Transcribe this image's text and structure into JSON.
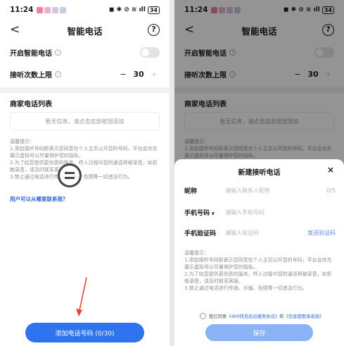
{
  "status": {
    "time": "11:24",
    "battery": "34",
    "icons": "◼ ✱ ⊘ ≋ ıll"
  },
  "blur_colors": [
    "#f07fa0",
    "#e7b2cc",
    "#d6c3dd",
    "#c9c9ea"
  ],
  "header": {
    "back": "<",
    "title": "智能电话",
    "help": "?"
  },
  "settings": {
    "enable_label": "开启智能电话",
    "limit_label": "接听次数上限",
    "limit_value": "30",
    "minus": "−",
    "plus": "+"
  },
  "list": {
    "title": "商家电话列表",
    "empty_text": "暂无信息，请点击底部按钮添加"
  },
  "notes_left": {
    "heading": "温馨提示：",
    "item1": "1.添加接听号码即表示您同意在个人主页公开您的号码，平台会优先展示虚拟号以尽量保护您的隐私。",
    "item2": "2.为了给您提供更优质的服务，呼入过程中您的通话将被录音，如拒绝录音，请及时联系客服。",
    "item3": "3.禁止通过电话进行传销、诈骗、色情等一切违法行为。"
  },
  "link_text": "用户可以从哪里联系我？",
  "add_button": "添加电话号码 (0/30)",
  "arrow_color": "#e8452f",
  "sheet": {
    "title": "新建接听电话",
    "close": "×",
    "nickname_label": "昵称",
    "nickname_placeholder": "请输入联系人昵称",
    "nickname_count": "0/5",
    "phone_label": "手机号码",
    "phone_caret": "∨",
    "phone_placeholder": "请输入手机号码",
    "code_label": "手机验证码",
    "code_placeholder": "请输入验证码",
    "send_code": "发送验证码",
    "notes_heading": "温馨提示：",
    "note1": "1.添加接听号码即表示您同意在个人主页公开您的号码，平台会优先展示虚拟号以尽量保护您的隐私。",
    "note2": "2.为了给您提供更优质的服务，呼入过程中您的通话将被录音，如拒绝录音，请及时联系客服。",
    "note3": "3.禁止通过电话进行传销、诈骗、色情等一切违法行为。",
    "agree_prefix": "我已同意",
    "agree_doc1": "《400快充后台服务协议》",
    "agree_and": "和",
    "agree_doc2": "《信息使用承诺函》",
    "save": "保存"
  }
}
